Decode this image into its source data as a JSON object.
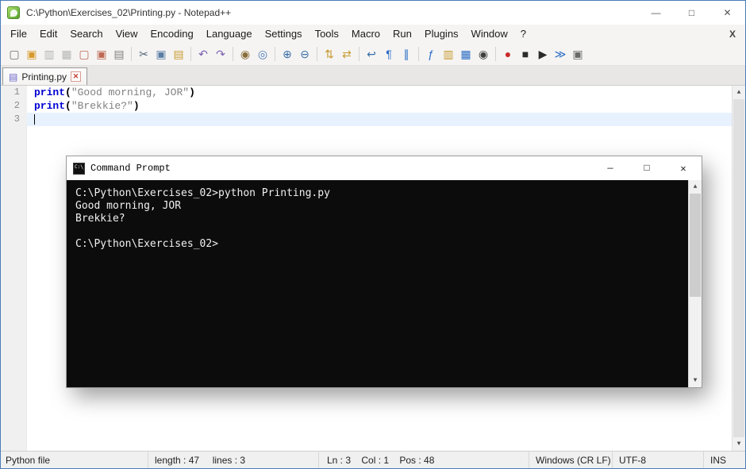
{
  "window": {
    "title": "C:\\Python\\Exercises_02\\Printing.py - Notepad++",
    "minimize": "—",
    "maximize": "□",
    "close": "✕"
  },
  "menubar": {
    "items": [
      "File",
      "Edit",
      "Search",
      "View",
      "Encoding",
      "Language",
      "Settings",
      "Tools",
      "Macro",
      "Run",
      "Plugins",
      "Window",
      "?"
    ],
    "close_button": "X"
  },
  "toolbar": {
    "groups": [
      [
        {
          "name": "new-file",
          "glyph": "▢",
          "color": "#6f6f6f"
        },
        {
          "name": "open-file",
          "glyph": "▣",
          "color": "#d79a2b"
        },
        {
          "name": "save-file",
          "glyph": "▥",
          "color": "#b5b5b5"
        },
        {
          "name": "save-all",
          "glyph": "▦",
          "color": "#b5b5b5"
        },
        {
          "name": "close-file",
          "glyph": "▢",
          "color": "#bf6a55"
        },
        {
          "name": "close-all",
          "glyph": "▣",
          "color": "#bf6a55"
        },
        {
          "name": "print",
          "glyph": "▤",
          "color": "#7d7d7d"
        }
      ],
      [
        {
          "name": "cut",
          "glyph": "✂",
          "color": "#55677a"
        },
        {
          "name": "copy",
          "glyph": "▣",
          "color": "#5b7da3"
        },
        {
          "name": "paste",
          "glyph": "▤",
          "color": "#c79a2f"
        }
      ],
      [
        {
          "name": "undo",
          "glyph": "↶",
          "color": "#7a5fae"
        },
        {
          "name": "redo",
          "glyph": "↷",
          "color": "#7a5fae"
        }
      ],
      [
        {
          "name": "find",
          "glyph": "◉",
          "color": "#8a6d3b"
        },
        {
          "name": "replace",
          "glyph": "◎",
          "color": "#4a7ab5"
        }
      ],
      [
        {
          "name": "zoom-in",
          "glyph": "⊕",
          "color": "#3a6ea5"
        },
        {
          "name": "zoom-out",
          "glyph": "⊖",
          "color": "#3a6ea5"
        }
      ],
      [
        {
          "name": "sync-vertical-scroll",
          "glyph": "⇅",
          "color": "#c79a2f"
        },
        {
          "name": "sync-horizontal-scroll",
          "glyph": "⇄",
          "color": "#c79a2f"
        }
      ],
      [
        {
          "name": "word-wrap",
          "glyph": "↩",
          "color": "#3a6ea5"
        },
        {
          "name": "show-all-characters",
          "glyph": "¶",
          "color": "#2b6cc4"
        },
        {
          "name": "indent-guide",
          "glyph": "∥",
          "color": "#2b6cc4"
        }
      ],
      [
        {
          "name": "function-list",
          "glyph": "ƒ",
          "color": "#2b6cc4"
        },
        {
          "name": "document-map",
          "glyph": "▥",
          "color": "#c79a2f"
        },
        {
          "name": "document-switcher",
          "glyph": "▦",
          "color": "#2b6cc4"
        },
        {
          "name": "monitoring",
          "glyph": "◉",
          "color": "#3f3f3f"
        }
      ],
      [
        {
          "name": "record-macro",
          "glyph": "●",
          "color": "#c92a2a"
        },
        {
          "name": "stop-macro",
          "glyph": "■",
          "color": "#2b2b2b"
        },
        {
          "name": "play-macro",
          "glyph": "▶",
          "color": "#2b2b2b"
        },
        {
          "name": "run-macro-multiple",
          "glyph": "≫",
          "color": "#2b6cc4"
        },
        {
          "name": "save-macro",
          "glyph": "▣",
          "color": "#6a6a6a"
        }
      ]
    ]
  },
  "tabbar": {
    "tabs": [
      {
        "label": "Printing.py",
        "icon": "▤",
        "close": "✕"
      }
    ]
  },
  "editor": {
    "lines": [
      {
        "number": "1",
        "current": false,
        "tokens": [
          {
            "text": "print",
            "type": "keyword"
          },
          {
            "text": "(",
            "type": "operator"
          },
          {
            "text": "\"Good morning, JOR\"",
            "type": "string"
          },
          {
            "text": ")",
            "type": "operator"
          }
        ]
      },
      {
        "number": "2",
        "current": false,
        "tokens": [
          {
            "text": "print",
            "type": "keyword"
          },
          {
            "text": "(",
            "type": "operator"
          },
          {
            "text": "\"Brekkie?\"",
            "type": "string"
          },
          {
            "text": ")",
            "type": "operator"
          }
        ]
      },
      {
        "number": "3",
        "current": true,
        "tokens": []
      }
    ]
  },
  "cmd": {
    "title": "Command Prompt",
    "icon_label": "C:\\_",
    "minimize": "—",
    "maximize": "□",
    "close": "✕",
    "lines": [
      "C:\\Python\\Exercises_02>python Printing.py",
      "Good morning, JOR",
      "Brekkie?",
      "",
      "C:\\Python\\Exercises_02>"
    ]
  },
  "scrollbar": {
    "up": "▲",
    "down": "▼"
  },
  "statusbar": {
    "doc_type": "Python file",
    "length_info": "length : 47     lines : 3",
    "position_info": "Ln : 3    Col : 1    Pos : 48",
    "eol": "Windows (CR LF)",
    "encoding": "UTF-8",
    "insert_mode": "INS"
  }
}
